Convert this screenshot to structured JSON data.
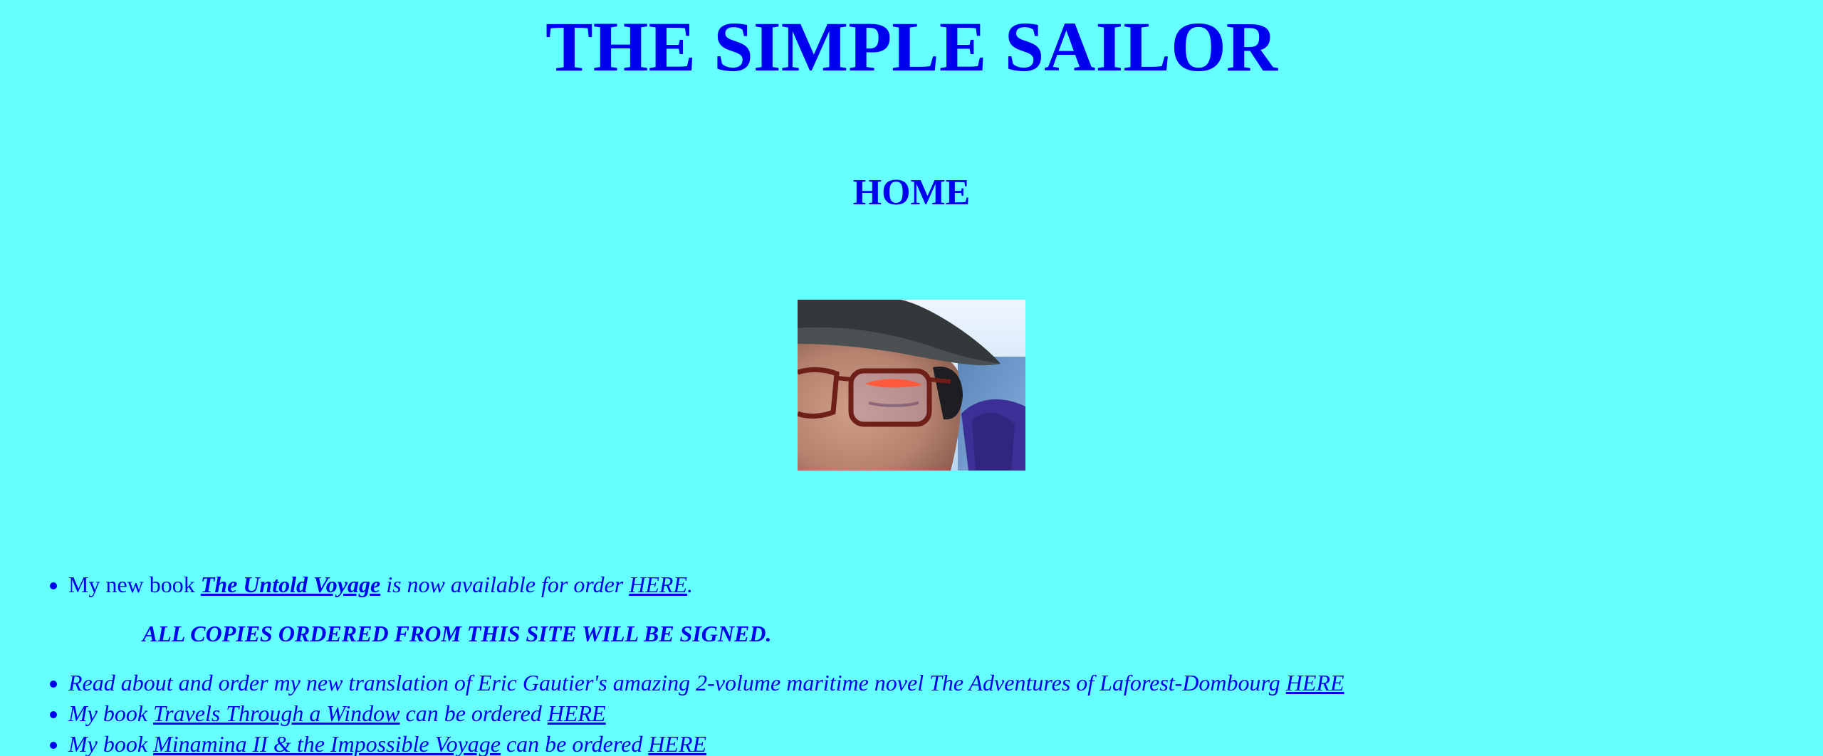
{
  "header": {
    "site_title": "THE SIMPLE SAILOR",
    "section_title": "HOME"
  },
  "portrait": {
    "description_icon": "sailor-portrait-photo"
  },
  "news": {
    "item1": {
      "text_before": "My new book ",
      "book_title": "The Untold Voyage",
      "text_middle": " is now available for order ",
      "link": "HERE",
      "text_after": "."
    },
    "signed_note": "ALL COPIES ORDERED FROM THIS SITE WILL BE SIGNED.",
    "item2": {
      "text": "Read about and order my new translation of Eric Gautier's amazing 2-volume maritime novel The Adventures of Laforest-Dombourg ",
      "link": "HERE"
    },
    "item3": {
      "text_before": "My book ",
      "book_title": "Travels Through a Window",
      "text_middle": " can be ordered ",
      "link": "HERE"
    },
    "item4": {
      "text_before": "My book ",
      "book_title": "Minamina II & the Impossible Voyage",
      "text_middle": " can be ordered ",
      "link": "HERE"
    }
  }
}
